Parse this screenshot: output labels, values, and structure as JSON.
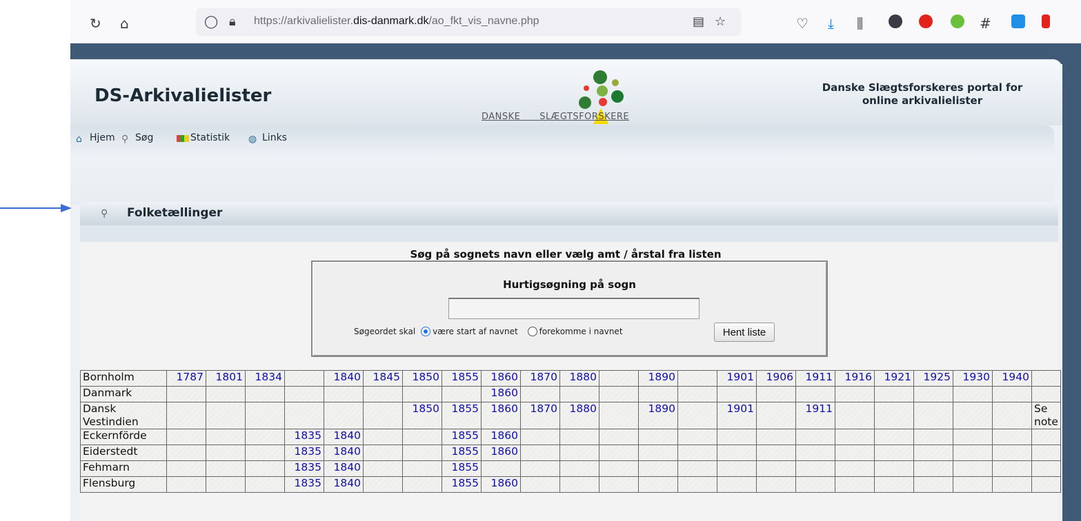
{
  "browser": {
    "url_prefix": "https://arkivalielister.",
    "url_domain": "dis-danmark.dk",
    "url_path": "/ao_fkt_vis_navne.php"
  },
  "header": {
    "site_title": "DS-Arkivalielister",
    "logo_text_left": "DANSKE",
    "logo_text_right": "SLÆGTSFORSKERE",
    "tagline_line1": "Danske Slægtsforskeres portal for",
    "tagline_line2": "online arkivalielister"
  },
  "nav": {
    "items": [
      {
        "label": "Hjem",
        "icon": "home-icon"
      },
      {
        "label": "Søg",
        "icon": "search-icon"
      },
      {
        "label": "Statistik",
        "icon": "chart-icon"
      },
      {
        "label": "Links",
        "icon": "globe-icon"
      }
    ]
  },
  "section": {
    "title": "Folketællinger",
    "instruction": "Søg på sognets navn eller vælg amt / årstal fra listen"
  },
  "search": {
    "heading": "Hurtigsøgning på sogn",
    "value": "",
    "mode_label": "Søgeordet skal",
    "option_start": "være start af navnet",
    "option_contains": "forekomme i navnet",
    "selected": "start",
    "button_label": "Hent liste"
  },
  "table": {
    "rows": [
      {
        "name": "Bornholm",
        "years": [
          "1787",
          "1801",
          "1834",
          "",
          "1840",
          "1845",
          "1850",
          "1855",
          "1860",
          "1870",
          "1880",
          "",
          "1890",
          "",
          "1901",
          "1906",
          "1911",
          "1916",
          "1921",
          "1925",
          "1930",
          "1940"
        ],
        "note": ""
      },
      {
        "name": "Danmark",
        "years": [
          "",
          "",
          "",
          "",
          "",
          "",
          "",
          "",
          "1860",
          "",
          "",
          "",
          "",
          "",
          "",
          "",
          "",
          "",
          "",
          "",
          "",
          ""
        ],
        "note": ""
      },
      {
        "name": "Dansk Vestindien",
        "years": [
          "",
          "",
          "",
          "",
          "",
          "",
          "1850",
          "1855",
          "1860",
          "1870",
          "1880",
          "",
          "1890",
          "",
          "1901",
          "",
          "1911",
          "",
          "",
          "",
          "",
          ""
        ],
        "note": "Se note"
      },
      {
        "name": "Eckernförde",
        "years": [
          "",
          "",
          "",
          "1835",
          "1840",
          "",
          "",
          "1855",
          "1860",
          "",
          "",
          "",
          "",
          "",
          "",
          "",
          "",
          "",
          "",
          "",
          "",
          ""
        ],
        "note": ""
      },
      {
        "name": "Eiderstedt",
        "years": [
          "",
          "",
          "",
          "1835",
          "1840",
          "",
          "",
          "1855",
          "1860",
          "",
          "",
          "",
          "",
          "",
          "",
          "",
          "",
          "",
          "",
          "",
          "",
          ""
        ],
        "note": ""
      },
      {
        "name": "Fehmarn",
        "years": [
          "",
          "",
          "",
          "1835",
          "1840",
          "",
          "",
          "1855",
          "",
          "",
          "",
          "",
          "",
          "",
          "",
          "",
          "",
          "",
          "",
          "",
          "",
          ""
        ],
        "note": ""
      },
      {
        "name": "Flensburg",
        "years": [
          "",
          "",
          "",
          "1835",
          "1840",
          "",
          "",
          "1855",
          "1860",
          "",
          "",
          "",
          "",
          "",
          "",
          "",
          "",
          "",
          "",
          "",
          "",
          ""
        ],
        "note": ""
      }
    ]
  }
}
